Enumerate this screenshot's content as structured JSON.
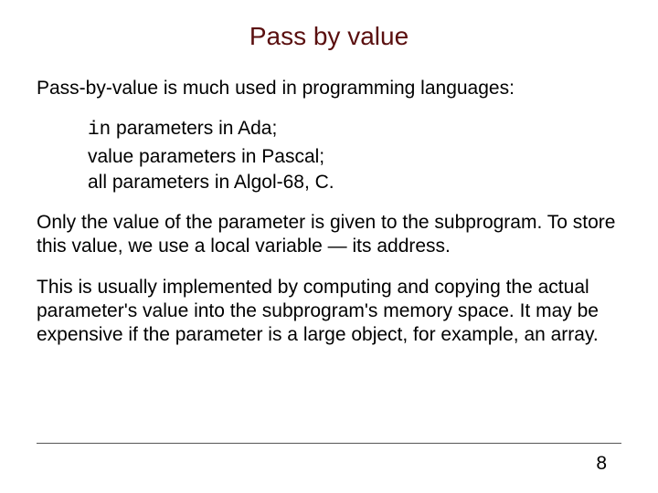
{
  "title": "Pass by value",
  "intro": "Pass-by-value is much used in programming languages:",
  "bullets": {
    "b1_code": "in",
    "b1_rest": " parameters in Ada;",
    "b2": "value parameters in Pascal;",
    "b3": "all parameters in Algol-68, C."
  },
  "para2": "Only the value of the parameter is given to the subprogram. To store this value, we use a local variable — its address.",
  "para3": "This is usually implemented by computing and copying the actual parameter's value into the subprogram's memory space. It may be expensive if the parameter is a large object, for example, an array.",
  "page_number": "8"
}
